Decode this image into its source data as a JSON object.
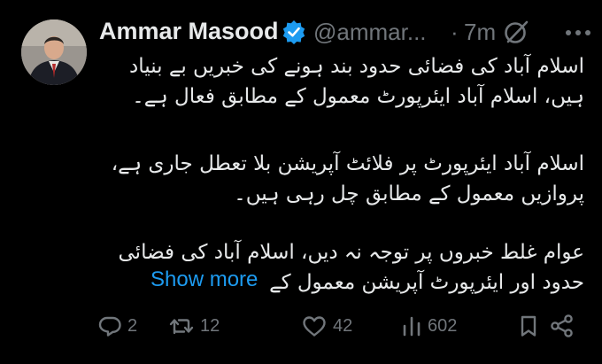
{
  "author": {
    "name": "Ammar Masood",
    "handle": "@ammar...",
    "separator": "·",
    "time": "7m"
  },
  "icons": {
    "verified": "verified-badge-icon",
    "grok": "no-entry-icon",
    "more": "more-options-icon",
    "reply": "reply-icon",
    "retweet": "retweet-icon",
    "like": "heart-icon",
    "views": "views-bar-chart-icon",
    "bookmark": "bookmark-icon",
    "share": "share-icon"
  },
  "tweet": {
    "p1_line1": "اسلام آباد کی فضائی حدود بند ہونے کی خبریں بے بنیاد",
    "p1_line2": "ہیں، اسلام آباد ایئرپورٹ معمول کے مطابق فعال ہے۔",
    "p2_line1": "اسلام آباد ایئرپورٹ پر فلائٹ آپریشن بلا تعطل جاری ہے،",
    "p2_line2": "پروازیں معمول کے مطابق چل رہی ہیں۔",
    "p3_line1": "عوام غلط خبروں پر توجہ نہ دیں، اسلام آباد کی فضائی",
    "p3_line2": "حدود اور ایئرپورٹ آپریشن معمول کے",
    "show_more": "Show more"
  },
  "stats": {
    "replies": "2",
    "retweets": "12",
    "likes": "42",
    "views": "602"
  },
  "colors": {
    "background": "#000000",
    "text": "#e7e9ea",
    "muted": "#71767b",
    "accent": "#1d9bf0"
  }
}
